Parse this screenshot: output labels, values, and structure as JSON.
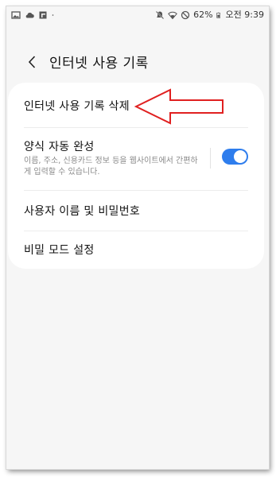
{
  "status_bar": {
    "battery": "62%",
    "time": "오전 9:39",
    "left_icons": [
      "gallery-icon",
      "cloud-icon",
      "app-icon",
      "dot-icon"
    ],
    "right_icons": [
      "mute-icon",
      "wifi-icon",
      "blocked-icon",
      "battery-icon"
    ]
  },
  "header": {
    "title": "인터넷 사용 기록"
  },
  "settings": {
    "items": [
      {
        "label": "인터넷 사용 기록 삭제"
      },
      {
        "label": "양식 자동 완성",
        "description": "이름, 주소, 신용카드 정보 등을 웹사이트에서 간편하게 입력할 수 있습니다.",
        "toggle_on": true
      },
      {
        "label": "사용자 이름 및 비밀번호"
      },
      {
        "label": "비밀 모드 설정"
      }
    ]
  },
  "colors": {
    "toggle": "#2e7ded",
    "annotation_arrow": "#e02020",
    "background": "#f6f6f6"
  }
}
